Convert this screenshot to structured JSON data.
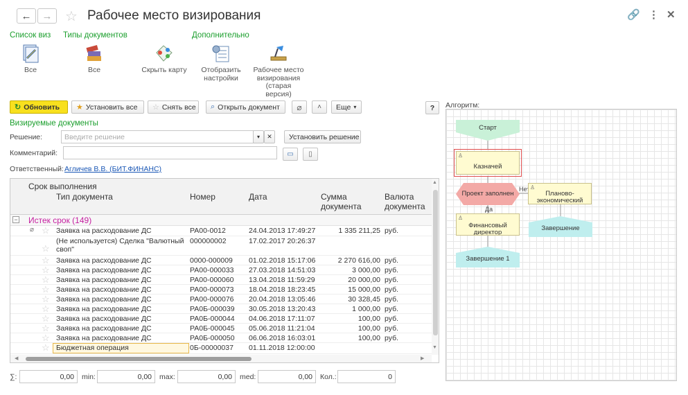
{
  "window": {
    "title": "Рабочее место визирования"
  },
  "sections": {
    "list": "Список виз",
    "doc_types": "Типы документов",
    "additional": "Дополнительно"
  },
  "commands": {
    "all_1": "Все",
    "all_2": "Все",
    "hide_map": "Скрыть карту",
    "show_settings": "Отобразить настройки",
    "old_workplace": "Рабочее место визирования (старая версия)"
  },
  "toolbar": {
    "refresh": "Обновить",
    "set_all": "Установить все",
    "clear_all": "Снять все",
    "open_doc": "Открыть документ",
    "more": "Еще",
    "help": "?"
  },
  "form": {
    "section_title": "Визируемые документы",
    "decision_label": "Решение:",
    "decision_placeholder": "Введите решение",
    "set_decision": "Установить решение",
    "comment_label": "Комментарий:",
    "responsible_label": "Ответственный:",
    "responsible_name": "Агличев В.В. (БИТ.ФИНАНС)"
  },
  "grid": {
    "headers": {
      "deadline": "Срок выполнения",
      "doc_type": "Тип документа",
      "number": "Номер",
      "date": "Дата",
      "amount": "Сумма документа",
      "currency": "Валюта документа"
    },
    "group": "Истек срок (149)",
    "rows": [
      {
        "type": "Заявка на расходование ДС",
        "number": "РА00-0012",
        "date": "24.04.2013 17:49:27",
        "amount": "1 335 211,25",
        "currency": "руб."
      },
      {
        "type": "(Не используется) Сделка \"Валютный своп\"",
        "number": "000000002",
        "date": "17.02.2017 20:26:37",
        "amount": "",
        "currency": ""
      },
      {
        "type": "Заявка на расходование ДС",
        "number": "0000-000009",
        "date": "01.02.2018 15:17:06",
        "amount": "2 270 616,00",
        "currency": "руб."
      },
      {
        "type": "Заявка на расходование ДС",
        "number": "РА00-000033",
        "date": "27.03.2018 14:51:03",
        "amount": "3 000,00",
        "currency": "руб."
      },
      {
        "type": "Заявка на расходование ДС",
        "number": "РА00-000060",
        "date": "13.04.2018 11:59:29",
        "amount": "20 000,00",
        "currency": "руб."
      },
      {
        "type": "Заявка на расходование ДС",
        "number": "РА00-000073",
        "date": "18.04.2018 18:23:45",
        "amount": "15 000,00",
        "currency": "руб."
      },
      {
        "type": "Заявка на расходование ДС",
        "number": "РА00-000076",
        "date": "20.04.2018 13:05:46",
        "amount": "30 328,45",
        "currency": "руб."
      },
      {
        "type": "Заявка на расходование ДС",
        "number": "РА0Б-000039",
        "date": "30.05.2018 13:20:43",
        "amount": "1 000,00",
        "currency": "руб."
      },
      {
        "type": "Заявка на расходование ДС",
        "number": "РА0Б-000044",
        "date": "04.06.2018 17:11:07",
        "amount": "100,00",
        "currency": "руб."
      },
      {
        "type": "Заявка на расходование ДС",
        "number": "РА0Б-000045",
        "date": "05.06.2018 11:21:04",
        "amount": "100,00",
        "currency": "руб."
      },
      {
        "type": "Заявка на расходование ДС",
        "number": "РА0Б-000050",
        "date": "06.06.2018 16:03:01",
        "amount": "100,00",
        "currency": "руб."
      },
      {
        "type": "Бюджетная операция",
        "number": "0Б-00000037",
        "date": "01.11.2018 12:00:00",
        "amount": "",
        "currency": ""
      }
    ]
  },
  "totals": {
    "sum_label": "∑:",
    "sum": "0,00",
    "min_label": "min:",
    "min": "0,00",
    "max_label": "max:",
    "max": "0,00",
    "med_label": "med:",
    "med": "0,00",
    "count_label": "Кол.:",
    "count": "0"
  },
  "algorithm": {
    "label": "Алгоритм:",
    "start": "Старт",
    "treasurer": "Казначей",
    "filled": "Проект заполнен",
    "no": "Нет",
    "yes": "Да",
    "planning": "Планово-экономический",
    "fin_director": "Финансовый директор",
    "finish": "Завершение",
    "finish1": "Завершение 1"
  },
  "colors": {
    "accent_green": "#1a9e2c",
    "group_magenta": "#c51fa0",
    "refresh_yellow": "#f8e01e",
    "link_blue": "#1a57b5"
  }
}
